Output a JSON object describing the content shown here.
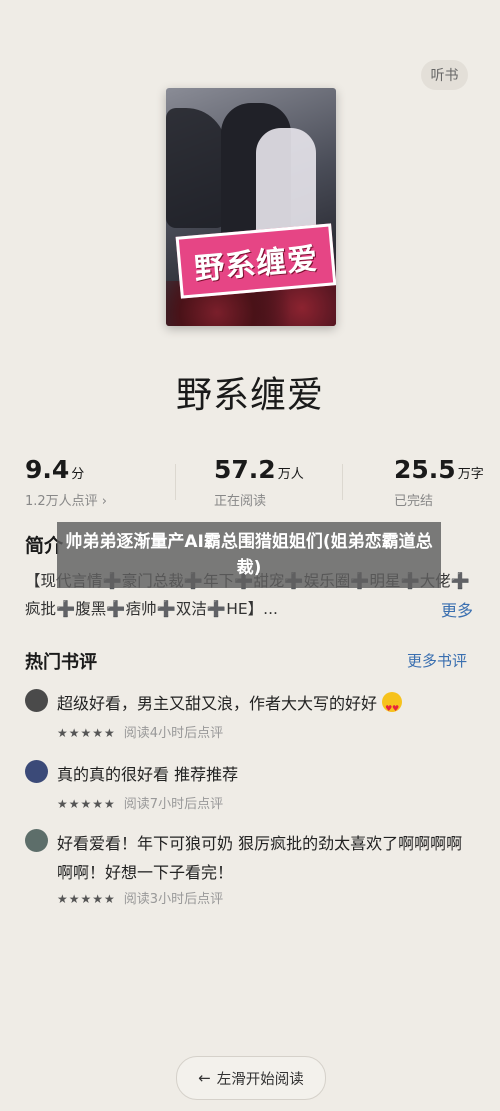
{
  "header": {
    "listen_label": "听书"
  },
  "book": {
    "cover_title": "野系缠爱",
    "title": "野系缠爱"
  },
  "stats": [
    {
      "value": "9.4",
      "unit": "分",
      "sub": "1.2万人点评 ›"
    },
    {
      "value": "57.2",
      "unit": "万人",
      "sub": "正在阅读"
    },
    {
      "value": "25.5",
      "unit": "万字",
      "sub": "已完结"
    }
  ],
  "intro": {
    "heading": "简介",
    "text": "【现代言情➕豪门总裁➕年下➕甜宠➕娱乐圈➕明星➕大佬➕疯批➕腹黑➕痞帅➕双洁➕HE】...",
    "more_label": "更多"
  },
  "overlay": {
    "text": "帅弟弟逐渐量产AI霸总围猎姐姐们(姐弟恋霸道总裁)"
  },
  "reviews_section": {
    "heading": "热门书评",
    "more_label": "更多书评",
    "reviews": [
      {
        "text": "超级好看，男主又甜又浪，作者大大写的好好",
        "stars": "★★★★★",
        "meta": "阅读4小时后点评",
        "avatar_color": "#4a4a4a"
      },
      {
        "text": "真的真的很好看 推荐推荐",
        "stars": "★★★★★",
        "meta": "阅读7小时后点评",
        "avatar_color": "#3b4a78"
      },
      {
        "text": "好看爱看！年下可狼可奶 狠厉疯批的劲太喜欢了啊啊啊啊啊啊！好想一下子看完！",
        "stars": "★★★★★",
        "meta": "阅读3小时后点评",
        "avatar_color": "#5d6e6a"
      }
    ]
  },
  "bottom": {
    "swipe_label": "左滑开始阅读",
    "arrow": "←"
  }
}
